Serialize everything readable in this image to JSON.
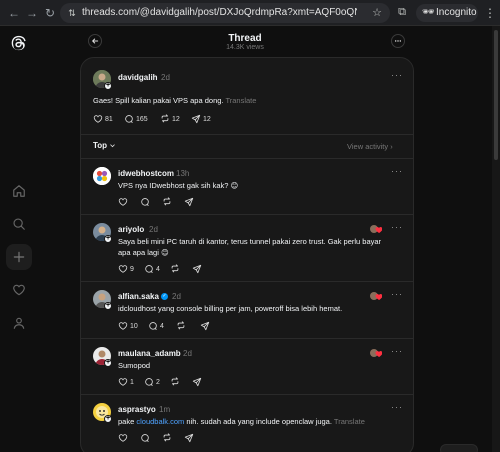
{
  "browser": {
    "url": "threads.com/@davidgalih/post/DXJoQrdmpRa?xmt=AQF0oQNf8mKkywHBSj6hKS...",
    "incognito_label": "Incognito"
  },
  "thread": {
    "title": "Thread",
    "views": "14.3K views"
  },
  "main_post": {
    "username": "davidgalih",
    "time": "2d",
    "text": "Gaes! Spill kalian pakai VPS apa dong.",
    "translate": "Translate",
    "likes": "81",
    "replies": "165",
    "reposts": "12",
    "shares": "12"
  },
  "sort": {
    "label": "Top",
    "view_activity": "View activity"
  },
  "replies": [
    {
      "username": "idwebhostcom",
      "time": "13h",
      "text": "VPS nya IDwebhost gak sih kak? 😊",
      "likes": "",
      "replies": "",
      "reposts": ""
    },
    {
      "username": "ariyolo",
      "time": "2d",
      "text1": "Saya beli mini PC taruh di kantor, terus tunnel pakai zero trust. Gak perlu bayar",
      "text2": "apa apa lagi 😊",
      "likes": "9",
      "replies": "4",
      "reposts": ""
    },
    {
      "username": "alfian.saka",
      "time": "2d",
      "text": "idcloudhost yang console billing per jam, poweroff bisa lebih hemat.",
      "likes": "10",
      "replies": "4",
      "reposts": ""
    },
    {
      "username": "maulana_adamb",
      "time": "2d",
      "text": "Sumopod",
      "likes": "1",
      "replies": "2",
      "reposts": ""
    },
    {
      "username": "asprastyo",
      "time": "1m",
      "text_pre": "pake",
      "text_link": "cloudbalk.com",
      "text_post": "nih. sudah ada yang include openclaw juga.",
      "translate": "Translate",
      "likes": "",
      "replies": "",
      "reposts": ""
    }
  ],
  "colors": {
    "background": "#0f0f0f",
    "card": "#181818",
    "text": "#f3f5f7",
    "muted": "#777777",
    "link": "#4fa3ff",
    "verified": "#0095f6"
  }
}
